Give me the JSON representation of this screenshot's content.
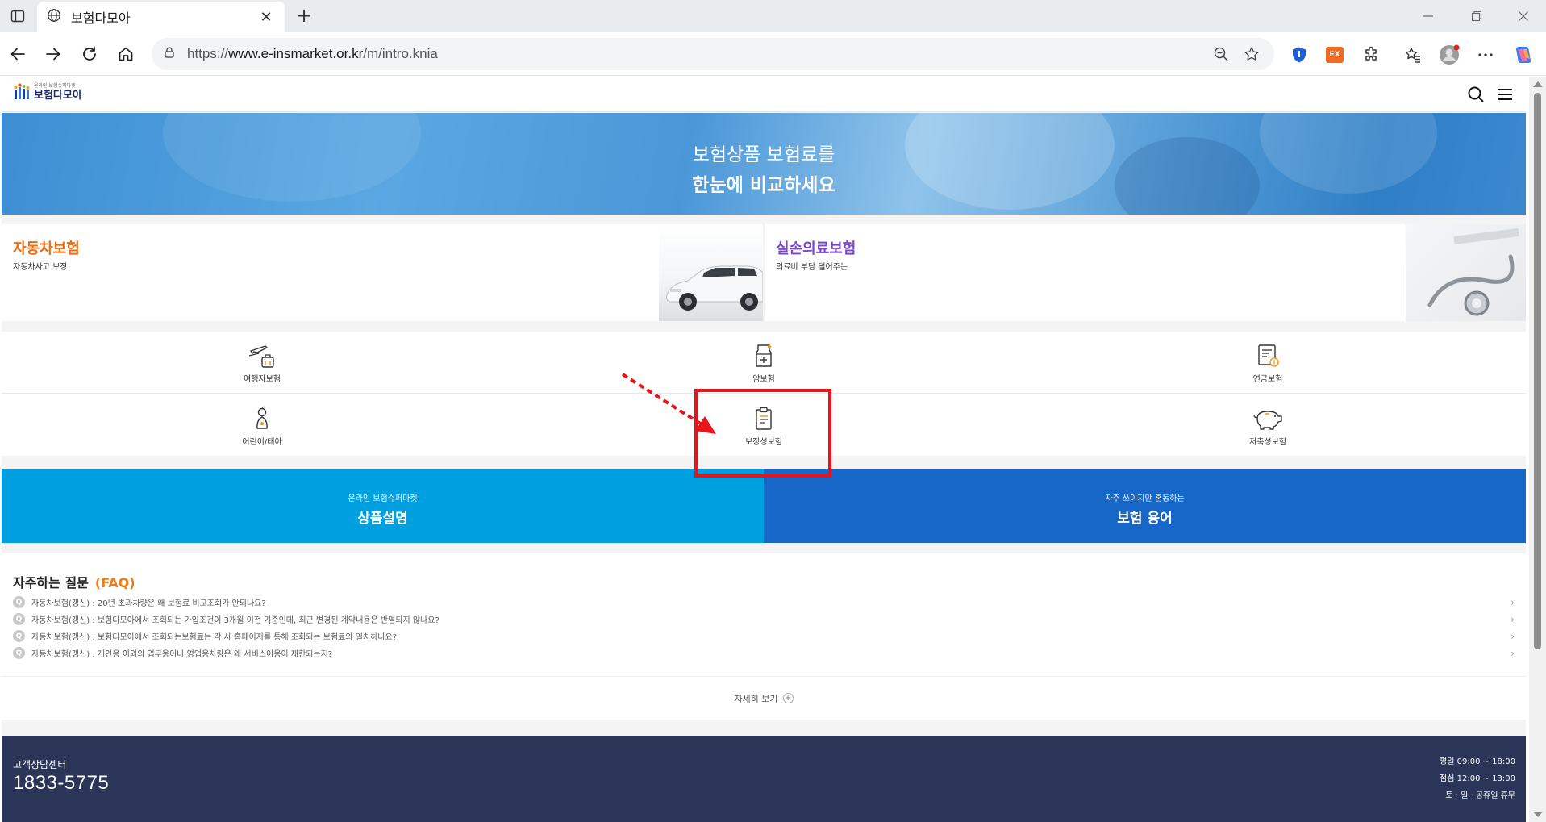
{
  "browser": {
    "tab_title": "보험다모아",
    "url_prefix": "https://",
    "url_host": "www.e-insmarket.or.kr",
    "url_path": "/m/intro.knia",
    "ext_badge": "EX"
  },
  "site": {
    "logo_small": "온라인 보험슈퍼마켓",
    "logo_name": "보험다모아"
  },
  "hero": {
    "line1": "보험상품 보험료를",
    "line2": "한눈에 비교하세요"
  },
  "features": [
    {
      "title": "자동차보험",
      "subtitle": "자동차사고 보장",
      "color": "#ef6c0f"
    },
    {
      "title": "실손의료보험",
      "subtitle": "의료비 부담 덜어주는",
      "color": "#7b45c8"
    }
  ],
  "products": [
    {
      "label": "여행자보험",
      "icon": "airplane-luggage-icon"
    },
    {
      "label": "암보험",
      "icon": "medical-bag-icon"
    },
    {
      "label": "연금보험",
      "icon": "pension-document-icon"
    },
    {
      "label": "어린이/태아",
      "icon": "baby-icon"
    },
    {
      "label": "보장성보험",
      "icon": "clipboard-icon"
    },
    {
      "label": "저축성보험",
      "icon": "piggy-bank-icon"
    }
  ],
  "info": [
    {
      "small": "온라인 보험슈퍼마켓",
      "big": "상품설명",
      "color": "#00a0e0"
    },
    {
      "small": "자주 쓰이지만 혼동하는",
      "big": "보험 용어",
      "color": "#1767c8"
    }
  ],
  "faq": {
    "title": "자주하는 질문",
    "title_accent": "(FAQ)",
    "badge": "Q",
    "items": [
      "자동차보험(갱신) : 20년 초과차량은 왜 보험료 비교조회가 안되나요?",
      "자동차보험(갱신) : 보험다모아에서 조회되는 가입조건이 3개월 이전 기준인데, 최근 변경된 계약내용은 반영되지 않나요?",
      "자동차보험(갱신) : 보험다모아에서 조회되는보험료는 각 사 홈페이지를 통해 조회되는 보험료와 일치하나요?",
      "자동차보험(갱신) : 개인용 이외의 업무용이나 영업용차량은 왜 서비스이용이 제한되는지?"
    ],
    "more": "자세히 보기"
  },
  "footer": {
    "cs_label": "고객상담센터",
    "phone": "1833-5775",
    "hours": [
      "평일 09:00 ~ 18:00",
      "점심 12:00 ~ 13:00",
      "토 · 일 · 공휴일 휴무"
    ]
  }
}
